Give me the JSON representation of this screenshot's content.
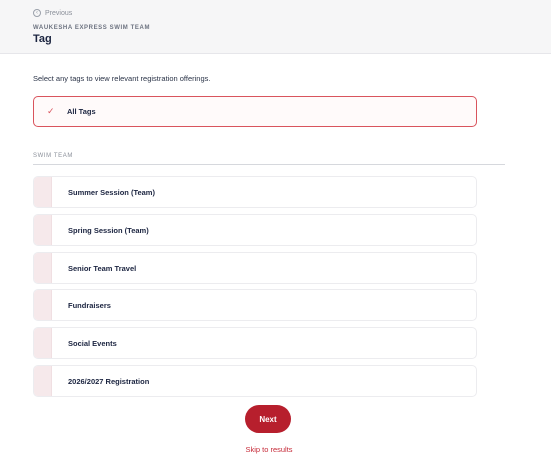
{
  "header": {
    "previous_label": "Previous",
    "organization": "WAUKESHA EXPRESS SWIM TEAM",
    "title": "Tag"
  },
  "instruction": "Select any tags to view relevant registration offerings.",
  "all_tags": {
    "label": "All Tags",
    "selected": true,
    "accent_color": "#d9545d"
  },
  "section": {
    "label": "SWIM TEAM",
    "tags": [
      {
        "label": "Summer Session (Team)"
      },
      {
        "label": "Spring Session (Team)"
      },
      {
        "label": "Senior Team Travel"
      },
      {
        "label": "Fundraisers"
      },
      {
        "label": "Social Events"
      },
      {
        "label": "2026/2027 Registration"
      }
    ]
  },
  "actions": {
    "next_label": "Next",
    "skip_label": "Skip to results",
    "primary_color": "#b71f2d"
  }
}
